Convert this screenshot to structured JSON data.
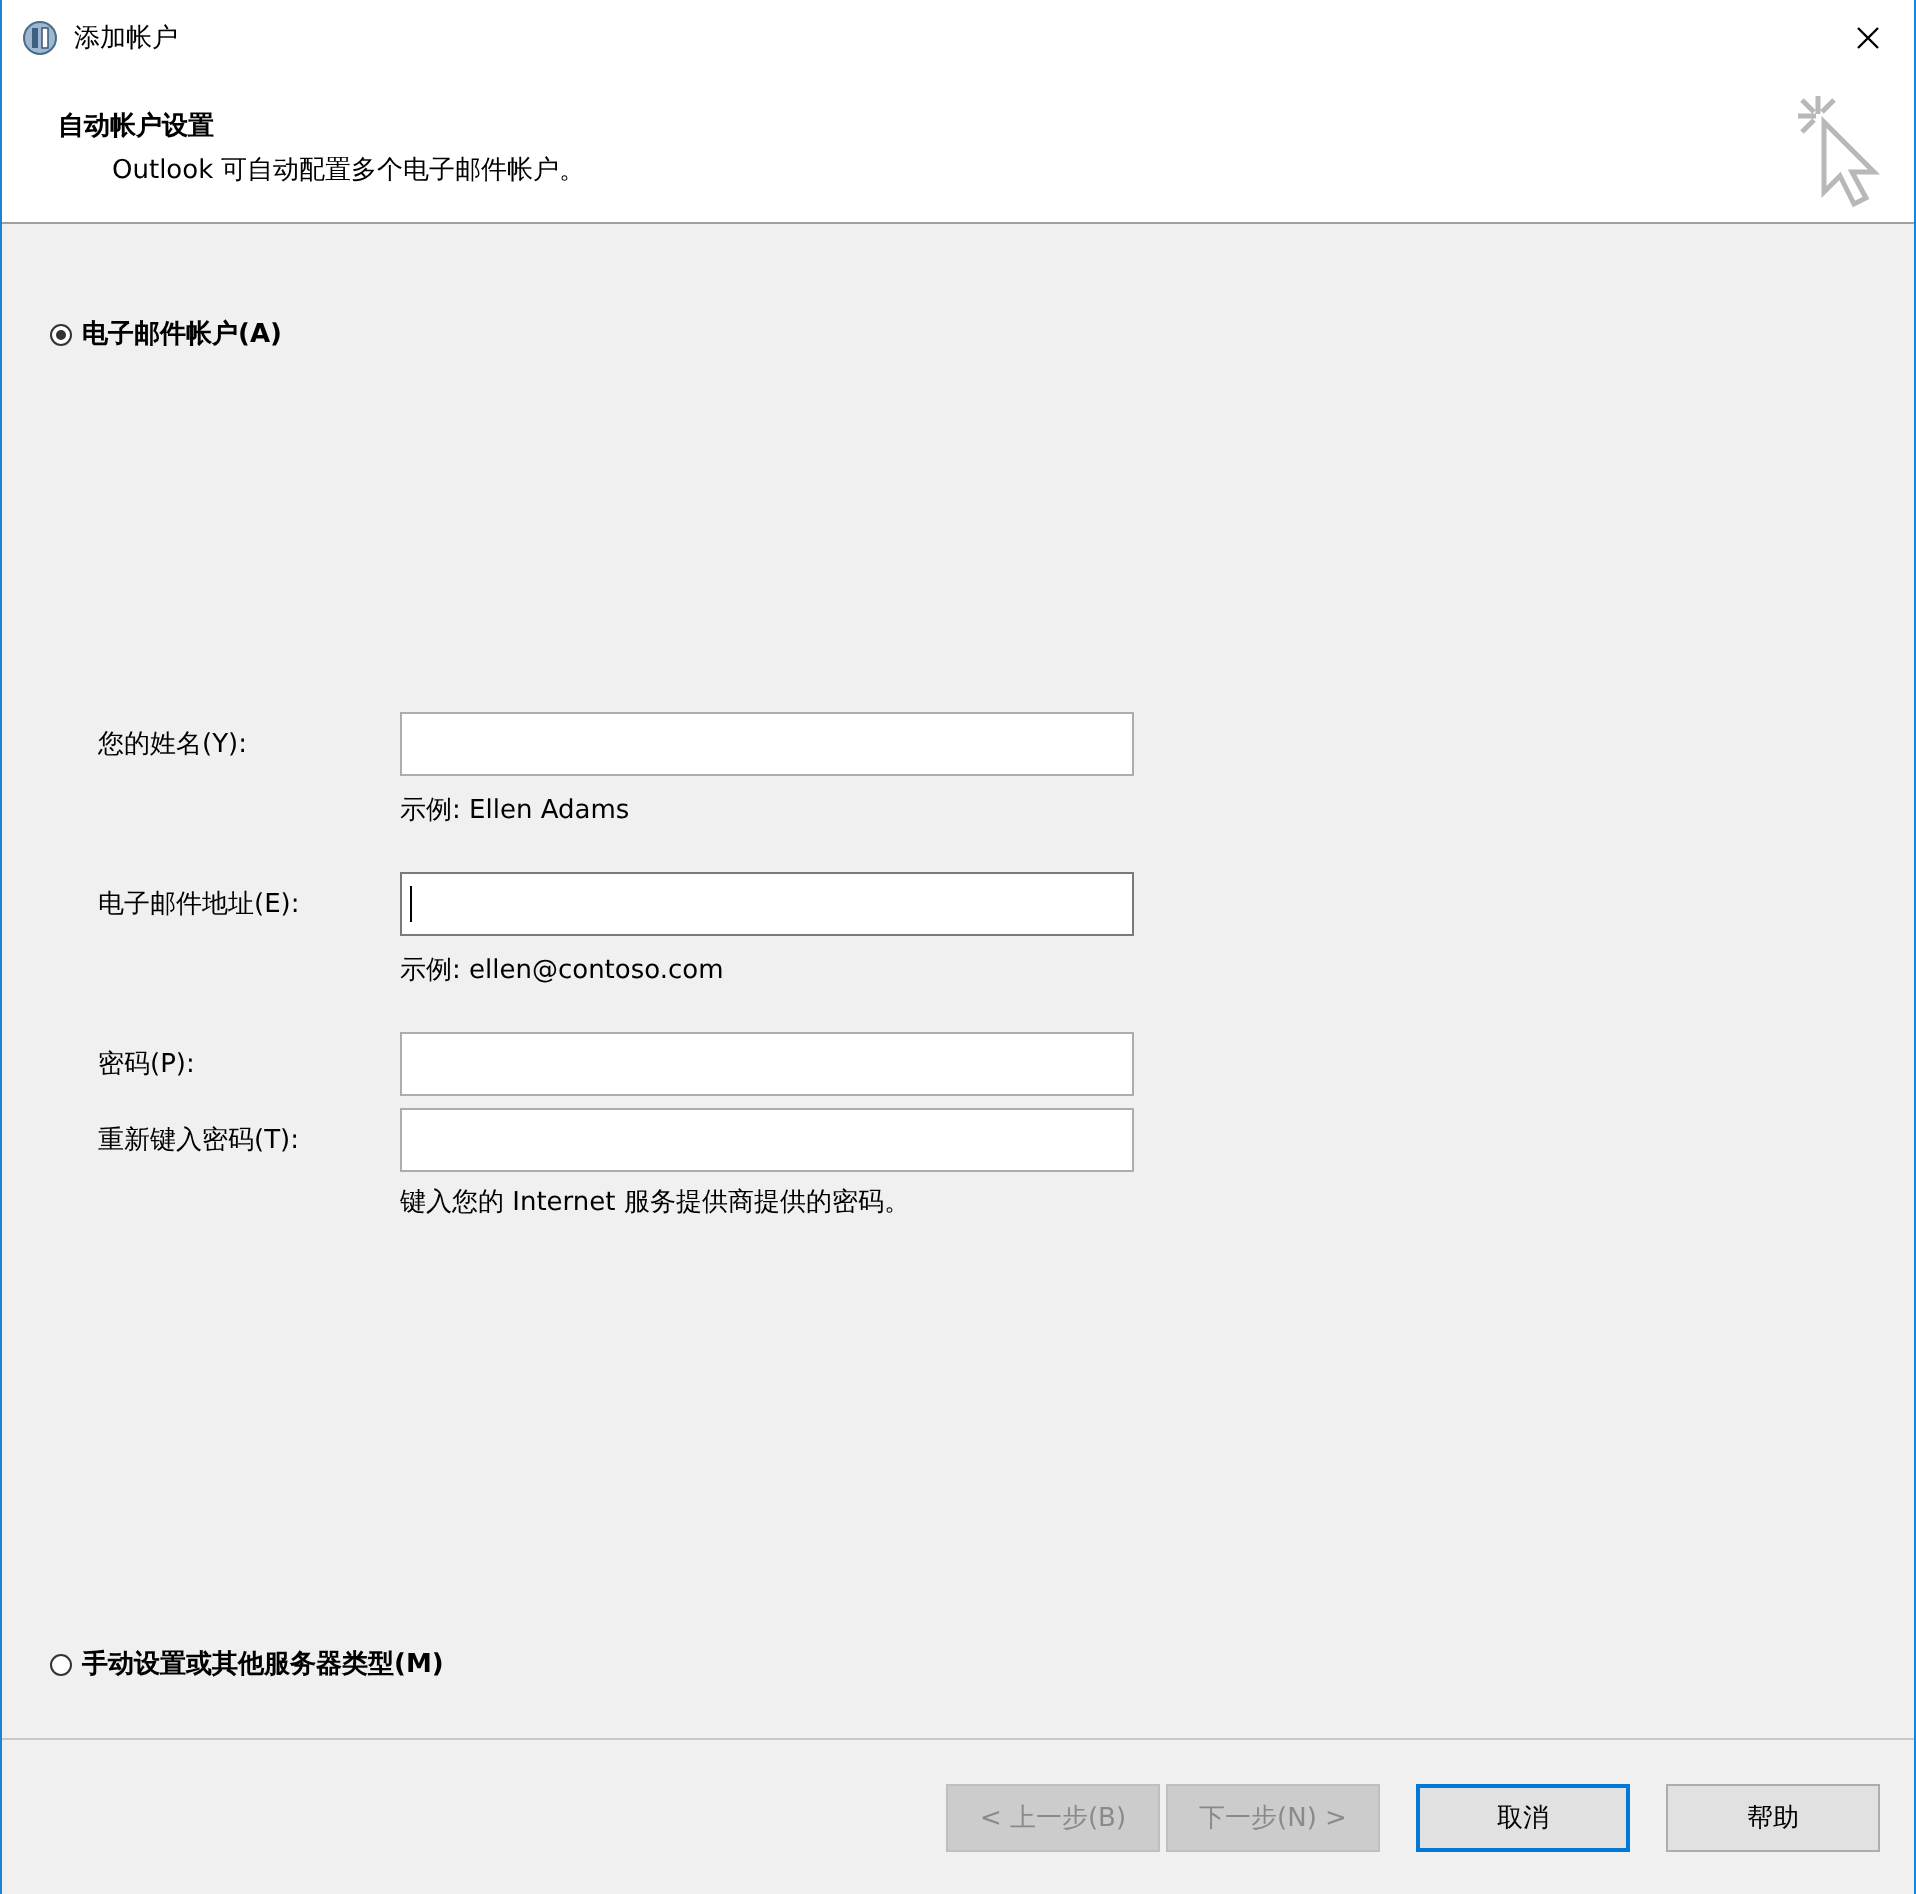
{
  "window": {
    "title": "添加帐户"
  },
  "header": {
    "title": "自动帐户设置",
    "subtitle": "Outlook 可自动配置多个电子邮件帐户。"
  },
  "options": [
    {
      "label": "电子邮件帐户(A)",
      "selected": true
    },
    {
      "label": "手动设置或其他服务器类型(M)",
      "selected": false
    }
  ],
  "fields": [
    {
      "label": "您的姓名(Y):",
      "focused": false,
      "hint": "示例: Ellen Adams"
    },
    {
      "label": "电子邮件地址(E):",
      "focused": true,
      "hint": "示例: ellen@contoso.com"
    },
    {
      "label": "密码(P):",
      "focused": false
    },
    {
      "label": "重新键入密码(T):",
      "focused": false,
      "hint": "键入您的 Internet 服务提供商提供的密码。"
    }
  ],
  "buttons": [
    {
      "label": "< 上一步(B)",
      "disabled": true,
      "focused": false
    },
    {
      "label": "下一步(N) >",
      "disabled": true,
      "focused": false
    },
    {
      "label": "取消",
      "disabled": false,
      "focused": true
    },
    {
      "label": "帮助",
      "disabled": false,
      "focused": false
    }
  ]
}
